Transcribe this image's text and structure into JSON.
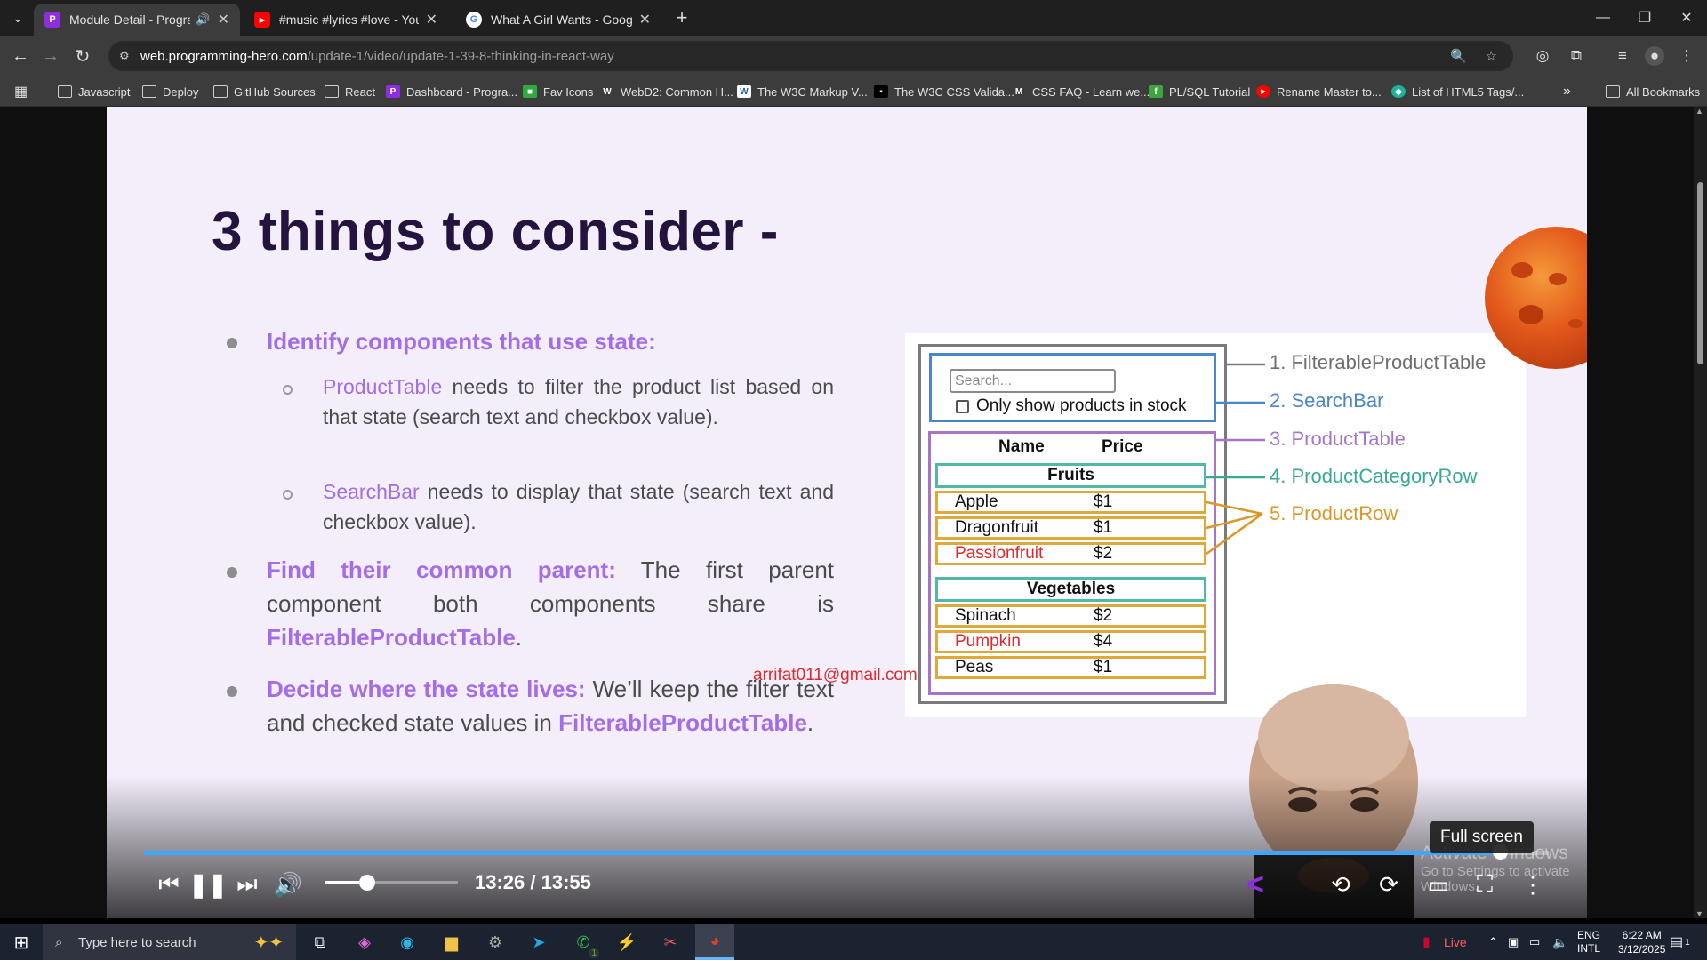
{
  "browser": {
    "tabs": [
      {
        "title": "Module Detail - Programmi",
        "favicon": "P",
        "color": "#8e2de2",
        "active": true,
        "audio": true
      },
      {
        "title": "#music #lyrics #love - YouTube",
        "favicon": "▶",
        "color": "#ff0000",
        "active": false,
        "audio": false
      },
      {
        "title": "What A Girl Wants - Google Se",
        "favicon": "G",
        "color": "#ffffff",
        "active": false,
        "audio": false
      }
    ],
    "url_host": "web.programming-hero.com",
    "url_path": "/update-1/video/update-1-39-8-thinking-in-react-way",
    "bookmarks": [
      {
        "label": "Javascript",
        "icon": "folder-icon"
      },
      {
        "label": "Deploy",
        "icon": "folder-icon"
      },
      {
        "label": "GitHub Sources",
        "icon": "folder-icon"
      },
      {
        "label": "React",
        "icon": "folder-icon"
      },
      {
        "label": "Dashboard - Progra...",
        "icon": "programming-hero-icon",
        "color": "#8e2de2"
      },
      {
        "label": "Fav Icons",
        "icon": "favicons-icon",
        "color": "#2faa3f"
      },
      {
        "label": "WebD2: Common H...",
        "icon": "w-icon",
        "color": "#333333"
      },
      {
        "label": "The W3C Markup V...",
        "icon": "w3c-icon",
        "color": "#ffffff"
      },
      {
        "label": "The W3C CSS Valida...",
        "icon": "w3c-css-icon",
        "color": "#333333"
      },
      {
        "label": "CSS FAQ - Learn we...",
        "icon": "m-icon",
        "color": "#333333"
      },
      {
        "label": "PL/SQL Tutorial",
        "icon": "plsql-icon",
        "color": "#3da53d"
      },
      {
        "label": "Rename Master to...",
        "icon": "youtube-icon",
        "color": "#ff0000"
      },
      {
        "label": "List of HTML5 Tags/...",
        "icon": "html5-icon",
        "color": "#1bb39a"
      }
    ],
    "all_bookmarks": "All Bookmarks"
  },
  "slide": {
    "title": "3 things to consider -",
    "b1_head": "Identify components that use state:",
    "s1_key": "ProductTable",
    "s1_text": " needs to filter the product list based on that state (search text and checkbox value).",
    "s2_key": "SearchBar",
    "s2_text": " needs to display that state (search text and checkbox value).",
    "b2_head": "Find their common parent:",
    "b2_text": " The first parent component both components share is ",
    "b2_key": "FilterableProductTable",
    "b2_end": ".",
    "b3_head": "Decide where the state lives:",
    "b3_text": " We’ll keep the filter text and checked state values in ",
    "b3_key": "FilterableProductTable",
    "b3_end": ".",
    "email": "arrifat011@gmail.com"
  },
  "diagram": {
    "search_placeholder": "Search...",
    "checkbox_label": "Only show products in stock",
    "col_name": "Name",
    "col_price": "Price",
    "cat1": "Fruits",
    "cat2": "Vegetables",
    "rows1": [
      {
        "name": "Apple",
        "price": "$1",
        "stocked": true
      },
      {
        "name": "Dragonfruit",
        "price": "$1",
        "stocked": true
      },
      {
        "name": "Passionfruit",
        "price": "$2",
        "stocked": false
      }
    ],
    "rows2": [
      {
        "name": "Spinach",
        "price": "$2",
        "stocked": true
      },
      {
        "name": "Pumpkin",
        "price": "$4",
        "stocked": false
      },
      {
        "name": "Peas",
        "price": "$1",
        "stocked": true
      }
    ],
    "labels": [
      {
        "text": "1. FilterableProductTable",
        "color": "#7a7a7a"
      },
      {
        "text": "2. SearchBar",
        "color": "#4a86c8"
      },
      {
        "text": "3. ProductTable",
        "color": "#a874c6"
      },
      {
        "text": "4. ProductCategoryRow",
        "color": "#3aa896"
      },
      {
        "text": "5. ProductRow",
        "color": "#d9982a"
      }
    ],
    "colors": {
      "table": "#7a7a7a",
      "search": "#4a86c8",
      "product": "#a874c6",
      "category": "#3aa896",
      "row": "#d9982a",
      "out_of_stock": "#e0282a"
    }
  },
  "player": {
    "current_time": "13:26",
    "separator": " / ",
    "duration": "13:55",
    "progress_fraction": 0.9653,
    "volume_fraction": 0.32,
    "tooltip": "Full screen",
    "activate_title": "Activate Windows",
    "activate_sub": "Go to Settings to activate Windows."
  },
  "taskbar": {
    "search_placeholder": "Type here to search",
    "live": "Live",
    "lang1": "ENG",
    "lang2": "INTL",
    "time": "6:22 AM",
    "date": "3/12/2025",
    "notification_count": "1",
    "whatsapp_badge": "1"
  }
}
